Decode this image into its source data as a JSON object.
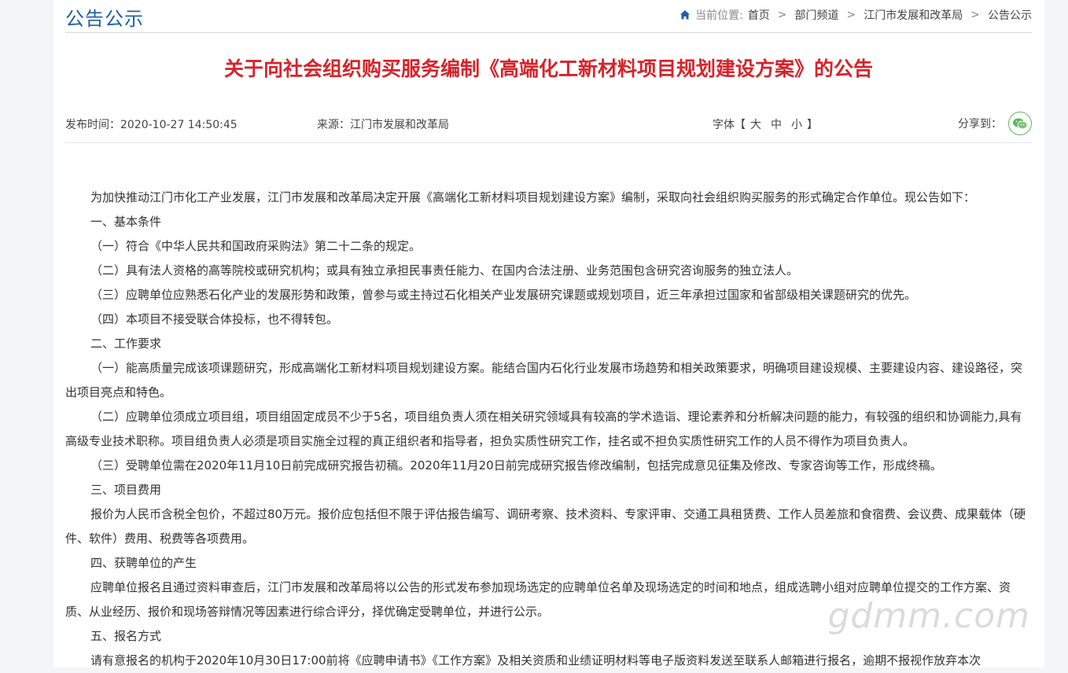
{
  "header": {
    "section_title": "公告公示",
    "breadcrumb": {
      "prefix": "当前位置:",
      "items": [
        "首页",
        "部门频道",
        "江门市发展和改革局",
        "公告公示"
      ],
      "separator": ">"
    }
  },
  "article": {
    "title": "关于向社会组织购买服务编制《高端化工新材料项目规划建设方案》的公告",
    "publish_time": "发布时间：2020-10-27 14:50:45",
    "source": "来源：江门市发展和改革局",
    "font_label": "字体【",
    "font_sizes": [
      "大",
      "中",
      "小"
    ],
    "font_close": "】",
    "share_label": "分享到：",
    "paragraphs": [
      "为加快推动江门市化工产业发展，江门市发展和改革局决定开展《高端化工新材料项目规划建设方案》编制，采取向社会组织购买服务的形式确定合作单位。现公告如下：",
      "一、基本条件",
      "（一）符合《中华人民共和国政府采购法》第二十二条的规定。",
      "（二）具有法人资格的高等院校或研究机构；或具有独立承担民事责任能力、在国内合法注册、业务范围包含研究咨询服务的独立法人。",
      "（三）应聘单位应熟悉石化产业的发展形势和政策，曾参与或主持过石化相关产业发展研究课题或规划项目，近三年承担过国家和省部级相关课题研究的优先。",
      "（四）本项目不接受联合体投标，也不得转包。",
      "二、工作要求",
      "（一）能高质量完成该项课题研究，形成高端化工新材料项目规划建设方案。能结合国内石化行业发展市场趋势和相关政策要求，明确项目建设规模、主要建设内容、建设路径，突出项目亮点和特色。",
      "（二）应聘单位须成立项目组，项目组固定成员不少于5名，项目组负责人须在相关研究领域具有较高的学术造诣、理论素养和分析解决问题的能力，有较强的组织和协调能力,具有高级专业技术职称。项目组负责人必须是项目实施全过程的真正组织者和指导者，担负实质性研究工作，挂名或不担负实质性研究工作的人员不得作为项目负责人。",
      "（三）受聘单位需在2020年11月10日前完成研究报告初稿。2020年11月20日前完成研究报告修改编制，包括完成意见征集及修改、专家咨询等工作，形成终稿。",
      "三、项目费用",
      "报价为人民币含税全包价，不超过80万元。报价应包括但不限于评估报告编写、调研考察、技术资料、专家评审、交通工具租赁费、工作人员差旅和食宿费、会议费、成果载体（硬件、软件）费用、税费等各项费用。",
      "四、获聘单位的产生",
      "应聘单位报名且通过资料审查后，江门市发展和改革局将以公告的形式发布参加现场选定的应聘单位名单及现场选定的时间和地点，组成选聘小组对应聘单位提交的工作方案、资质、从业经历、报价和现场答辩情况等因素进行综合评分，择优确定受聘单位，并进行公示。",
      "五、报名方式",
      "请有意报名的机构于2020年10月30日17:00前将《应聘申请书》《工作方案》及相关资质和业绩证明材料等电子版资料发送至联系人邮箱进行报名，逾期不报视作放弃本次"
    ]
  },
  "watermark": "gdmm.com",
  "colors": {
    "title_red": "#d8232a",
    "section_blue": "#1f5fa8",
    "wechat_green": "#5cb85c"
  }
}
